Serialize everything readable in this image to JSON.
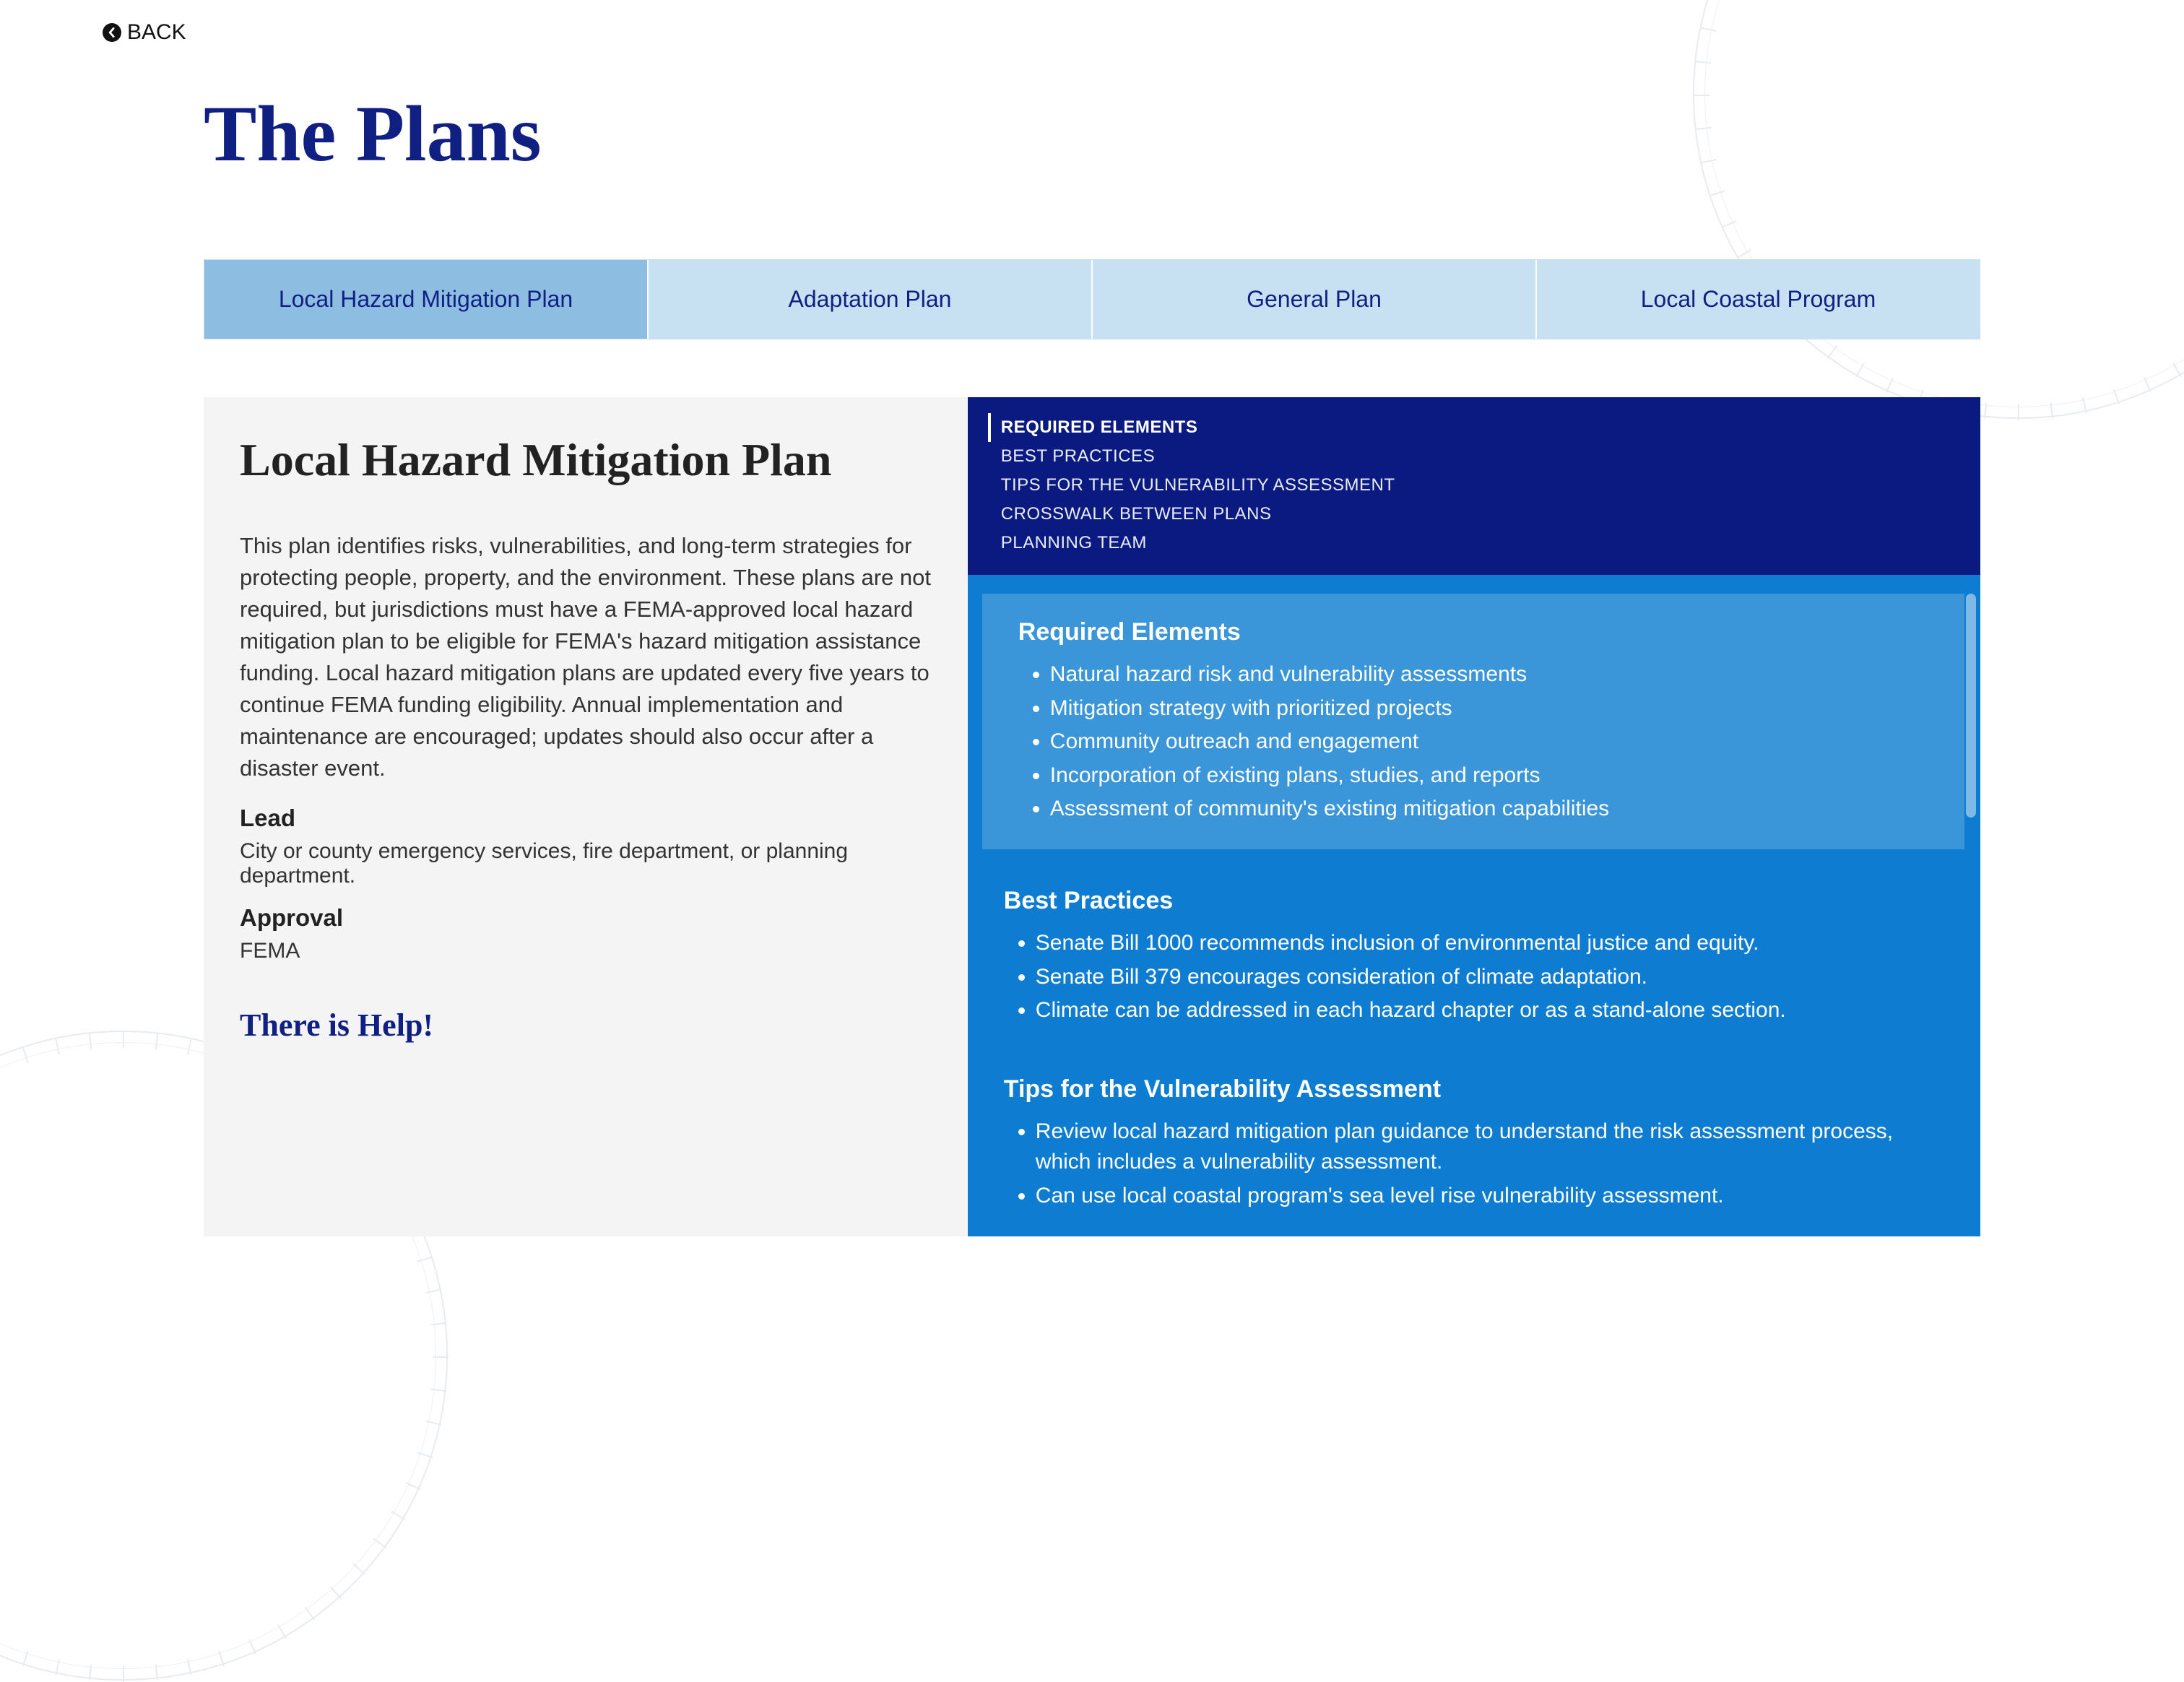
{
  "back_label": "BACK",
  "page_title": "The Plans",
  "tabs": [
    {
      "label": "Local Hazard Mitigation Plan",
      "active": true
    },
    {
      "label": "Adaptation Plan",
      "active": false
    },
    {
      "label": "General Plan",
      "active": false
    },
    {
      "label": "Local Coastal Program",
      "active": false
    }
  ],
  "left": {
    "heading": "Local Hazard Mitigation Plan",
    "body": "This plan identifies risks, vulnerabilities, and long-term strategies for protecting people, property, and the environment. These plans are not required, but jurisdictions must have a FEMA-approved local hazard mitigation plan to be eligible for FEMA's hazard mitigation assistance funding. Local hazard mitigation plans are updated every five years to continue FEMA funding eligibility. Annual implementation and maintenance are encouraged; updates should also occur after a disaster event.",
    "lead_label": "Lead",
    "lead_value": "City or county emergency services, fire department, or planning department.",
    "approval_label": "Approval",
    "approval_value": "FEMA",
    "help_heading": "There is Help!"
  },
  "toc": [
    {
      "label": "REQUIRED ELEMENTS",
      "active": true
    },
    {
      "label": "BEST PRACTICES",
      "active": false
    },
    {
      "label": "TIPS FOR THE VULNERABILITY ASSESSMENT",
      "active": false
    },
    {
      "label": "CROSSWALK BETWEEN PLANS",
      "active": false
    },
    {
      "label": "PLANNING TEAM",
      "active": false
    }
  ],
  "panels": {
    "required": {
      "title": "Required Elements",
      "items": [
        "Natural hazard risk and vulnerability assessments",
        "Mitigation strategy with prioritized projects",
        "Community outreach and engagement",
        "Incorporation of existing plans, studies, and reports",
        "Assessment of community's existing mitigation capabilities"
      ]
    },
    "best": {
      "title": "Best Practices",
      "items": [
        "Senate Bill 1000 recommends inclusion of environmental justice and equity.",
        "Senate Bill 379 encourages consideration of climate adaptation.",
        "Climate can be addressed in each hazard chapter or as a stand-alone section."
      ]
    },
    "tips": {
      "title": "Tips for the Vulnerability Assessment",
      "items": [
        "Review local hazard mitigation plan guidance to understand the risk assessment process, which includes a vulnerability assessment.",
        "Can use local coastal program's sea level rise vulnerability assessment."
      ]
    }
  }
}
